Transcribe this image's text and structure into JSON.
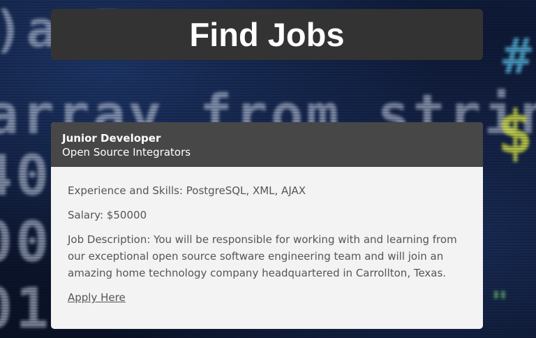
{
  "page": {
    "title": "Find Jobs"
  },
  "job": {
    "title": "Junior Developer",
    "company": "Open Source Integrators",
    "skills_label": "Experience and Skills: PostgreSQL, XML, AJAX",
    "salary_label": "Salary: $50000",
    "description_label": "Job Description: You will be responsible for working with and learning from our exceptional open source software engineering team and will join an amazing home technology company headquartered in Carrollton, Texas.",
    "apply_label": "Apply Here"
  },
  "colors": {
    "title_bar_bg": "#333333",
    "card_header_bg": "#474747",
    "card_body_bg": "#f3f3f3",
    "body_text": "#555555"
  }
}
